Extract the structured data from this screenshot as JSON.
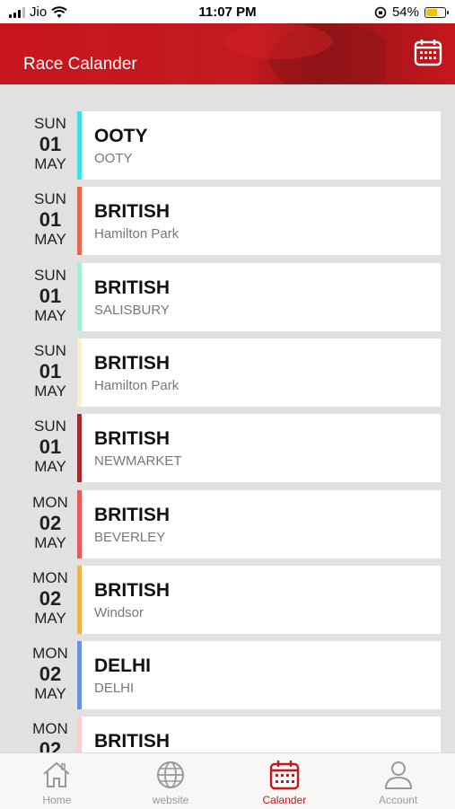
{
  "status_bar": {
    "carrier": "Jio",
    "time": "11:07 PM",
    "battery": "54%",
    "battery_level": 0.54,
    "icons": [
      "signal-icon",
      "wifi-icon",
      "orientation-lock-icon",
      "battery-charging-icon"
    ]
  },
  "header": {
    "title": "Race Calander",
    "action_icon": "calendar-icon"
  },
  "races": [
    {
      "dow": "SUN",
      "day": "01",
      "month": "MAY",
      "venue": "OOTY",
      "track": "OOTY",
      "color": "#3fe0e8"
    },
    {
      "dow": "SUN",
      "day": "01",
      "month": "MAY",
      "venue": "BRITISH",
      "track": "Hamilton Park",
      "color": "#e8664b"
    },
    {
      "dow": "SUN",
      "day": "01",
      "month": "MAY",
      "venue": "BRITISH",
      "track": "SALISBURY",
      "color": "#9ff0d4"
    },
    {
      "dow": "SUN",
      "day": "01",
      "month": "MAY",
      "venue": "BRITISH",
      "track": "Hamilton Park",
      "color": "#f4f1d2"
    },
    {
      "dow": "SUN",
      "day": "01",
      "month": "MAY",
      "venue": "BRITISH",
      "track": "NEWMARKET",
      "color": "#a22a2d"
    },
    {
      "dow": "MON",
      "day": "02",
      "month": "MAY",
      "venue": "BRITISH",
      "track": "BEVERLEY",
      "color": "#e85a5a"
    },
    {
      "dow": "MON",
      "day": "02",
      "month": "MAY",
      "venue": "BRITISH",
      "track": "Windsor",
      "color": "#f0b24a"
    },
    {
      "dow": "MON",
      "day": "02",
      "month": "MAY",
      "venue": "DELHI",
      "track": "DELHI",
      "color": "#6a93de"
    },
    {
      "dow": "MON",
      "day": "02",
      "month": "",
      "venue": "BRITISH",
      "track": "",
      "color": "#f7d0d0"
    }
  ],
  "tabs": [
    {
      "label": "Home",
      "icon": "home-icon",
      "active": false
    },
    {
      "label": "website",
      "icon": "globe-icon",
      "active": false
    },
    {
      "label": "Calander",
      "icon": "calendar-icon",
      "active": true
    },
    {
      "label": "Account",
      "icon": "user-icon",
      "active": false
    }
  ],
  "colors": {
    "brand_red": "#c8161d",
    "list_background": "#e1e1e1",
    "tab_inactive": "#999999"
  }
}
